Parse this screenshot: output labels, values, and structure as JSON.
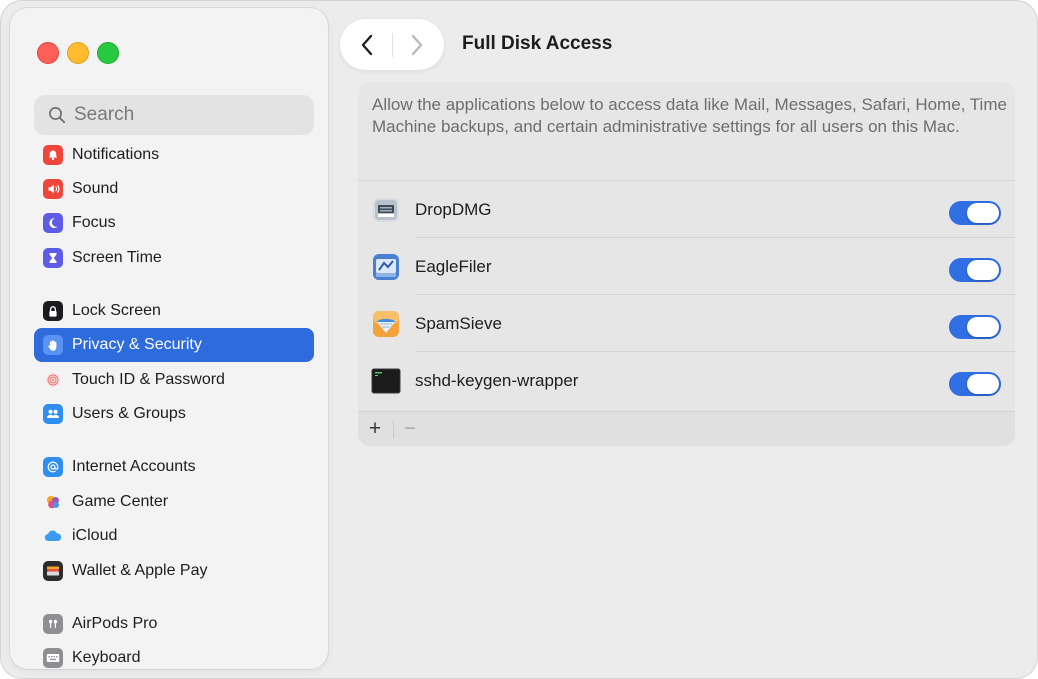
{
  "window": {
    "traffic_lights": [
      "close",
      "minimize",
      "maximize"
    ]
  },
  "sidebar": {
    "search_placeholder": "Search",
    "items": [
      {
        "label": "Notifications",
        "icon": "bell-icon",
        "color": "#f0453a",
        "active": false
      },
      {
        "label": "Sound",
        "icon": "speaker-icon",
        "color": "#f0453a",
        "active": false
      },
      {
        "label": "Focus",
        "icon": "moon-icon",
        "color": "#5e5ce6",
        "active": false
      },
      {
        "label": "Screen Time",
        "icon": "hourglass-icon",
        "color": "#5e5ce6",
        "active": false
      },
      {
        "label": "Lock Screen",
        "icon": "lock-icon",
        "color": "#1c1c1e",
        "active": false
      },
      {
        "label": "Privacy & Security",
        "icon": "hand-icon",
        "color": "#2e6bdc",
        "active": true
      },
      {
        "label": "Touch ID & Password",
        "icon": "fingerprint-icon",
        "color": "#f26d6d",
        "active": false
      },
      {
        "label": "Users & Groups",
        "icon": "users-icon",
        "color": "#2f8ef0",
        "active": false
      },
      {
        "label": "Internet Accounts",
        "icon": "at-icon",
        "color": "#2f8ef0",
        "active": false
      },
      {
        "label": "Game Center",
        "icon": "game-center-icon",
        "color": "#e24a8d",
        "active": false
      },
      {
        "label": "iCloud",
        "icon": "cloud-icon",
        "color": "#3b9bf0",
        "active": false
      },
      {
        "label": "Wallet & Apple Pay",
        "icon": "wallet-icon",
        "color": "#2c2c2e",
        "active": false
      },
      {
        "label": "AirPods Pro",
        "icon": "airpods-icon",
        "color": "#8e8e93",
        "active": false
      },
      {
        "label": "Keyboard",
        "icon": "keyboard-icon",
        "color": "#8e8e93",
        "active": false
      }
    ]
  },
  "toolbar": {
    "title": "Full Disk Access"
  },
  "content": {
    "description": "Allow the applications below to access data like Mail, Messages, Safari, Home, Time Machine backups, and certain administrative settings for all users on this Mac.",
    "apps": [
      {
        "name": "DropDMG",
        "icon": "dropdmg-icon",
        "enabled": true
      },
      {
        "name": "EagleFiler",
        "icon": "eaglefiler-icon",
        "enabled": true
      },
      {
        "name": "SpamSieve",
        "icon": "spamsieve-icon",
        "enabled": true
      },
      {
        "name": "sshd-keygen-wrapper",
        "icon": "terminal-exec-icon",
        "enabled": true
      }
    ],
    "add_label": "+",
    "remove_label": "−"
  },
  "colors": {
    "accent": "#2e6bdc",
    "toggle_on": "#2f6ee3"
  }
}
